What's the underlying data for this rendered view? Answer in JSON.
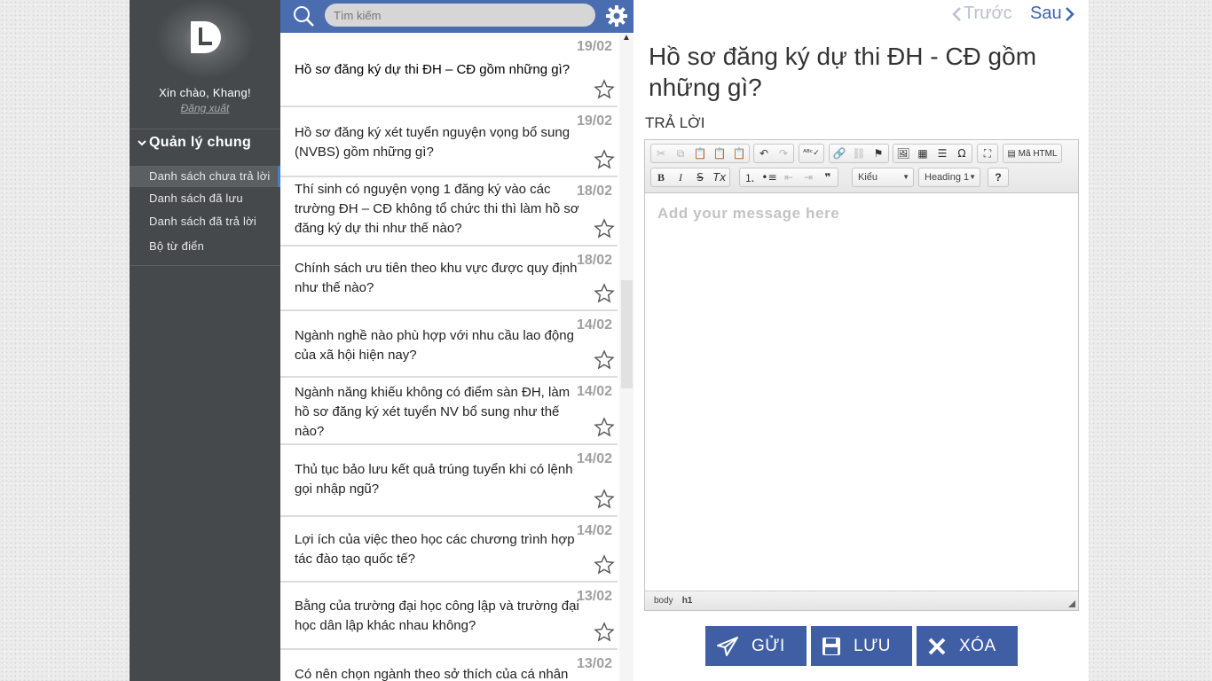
{
  "sidebar": {
    "greeting": "Xin chào, Khang!",
    "logout": "Đăng xuất",
    "group_title": "Quản lý chung",
    "items": [
      {
        "label": "Danh sách chưa trả lời"
      },
      {
        "label": "Danh sách đã lưu"
      },
      {
        "label": "Danh sách đã trả lời"
      },
      {
        "label": "Bộ từ điển"
      }
    ]
  },
  "search": {
    "placeholder": "Tìm kiếm"
  },
  "questions": [
    {
      "date": "19/02",
      "text": "Hồ sơ đăng ký dự thi ĐH – CĐ gồm những gì?"
    },
    {
      "date": "19/02",
      "text": "Hồ sơ đăng ký xét tuyển nguyện vọng bổ sung (NVBS) gồm những gì?"
    },
    {
      "date": "18/02",
      "text": "Thí sinh có nguyện vọng 1 đăng ký vào các trường ĐH – CĐ không tổ chức thi thì làm hồ sơ đăng ký dự thi như thế nào?"
    },
    {
      "date": "18/02",
      "text": "Chính sách ưu tiên theo khu vực được quy định như thế nào?"
    },
    {
      "date": "14/02",
      "text": "Ngành nghề nào phù hợp với nhu cầu lao động của xã hội hiện nay?"
    },
    {
      "date": "14/02",
      "text": "Ngành năng khiếu không có điểm sàn ĐH, làm hồ sơ đăng ký xét tuyển NV bổ sung như thế nào?"
    },
    {
      "date": "14/02",
      "text": "Thủ tục bảo lưu kết quả trúng tuyển khi có lệnh gọi nhập ngũ?"
    },
    {
      "date": "14/02",
      "text": "Lợi ích của việc theo học các chương trình hợp tác đào tạo quốc tế?"
    },
    {
      "date": "13/02",
      "text": "Bằng của trường đại học công lập và trường đại học dân lập khác nhau không?"
    },
    {
      "date": "13/02",
      "text": "Có nên chọn ngành theo sở thích của cá nhân"
    }
  ],
  "detail": {
    "prev": "Trước",
    "next": "Sau",
    "title": "Hồ sơ đăng ký dự thi ĐH - CĐ gồm những gì?",
    "answer_label": "TRẢ LỜI",
    "editor_placeholder": "Add your message here",
    "toolbar": {
      "source_label": "Mã HTML",
      "style_combo": "Kiểu",
      "format_combo": "Heading 1",
      "help": "?"
    },
    "statusbar": [
      "body",
      "h1"
    ],
    "buttons": {
      "send": "GỬI",
      "save": "LƯU",
      "delete": "XÓA"
    }
  },
  "colors": {
    "accent": "#4a6db0",
    "sidebar": "#45494c",
    "button": "#3f5ea3"
  }
}
